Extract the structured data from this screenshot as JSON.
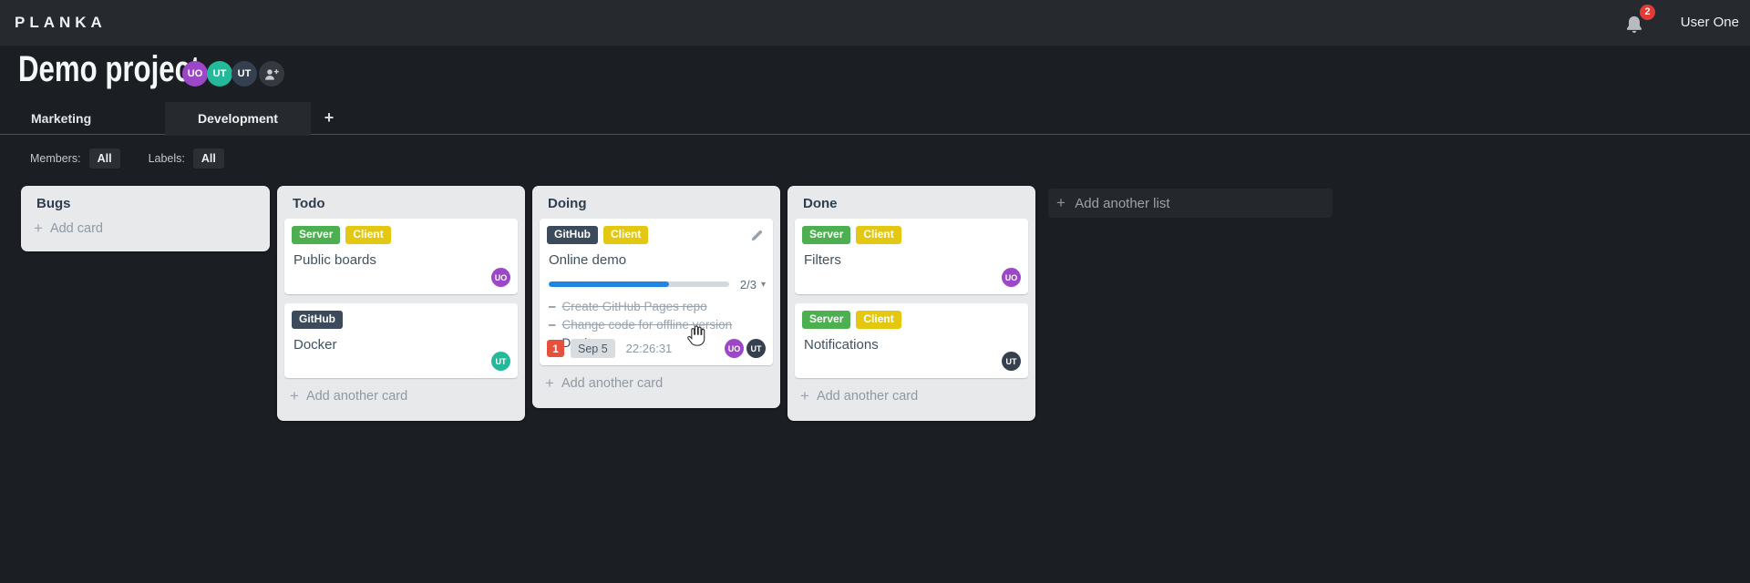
{
  "topbar": {
    "logo": "PLANKA",
    "user": "User One",
    "notification_count": "2"
  },
  "project": {
    "title": "Demo project",
    "members": [
      {
        "initials": "UO",
        "color": "#9c47c7"
      },
      {
        "initials": "UT",
        "color": "#23ba9b"
      },
      {
        "initials": "UT",
        "color": "#34404e"
      }
    ]
  },
  "tabs": {
    "items": [
      {
        "label": "Marketing"
      },
      {
        "label": "Development"
      }
    ],
    "add_button": "+"
  },
  "filters": {
    "members_label": "Members:",
    "members_value": "All",
    "labels_label": "Labels:",
    "labels_value": "All"
  },
  "board": {
    "add_list_label": "Add another list",
    "lists": [
      {
        "name": "Bugs",
        "add_card_label": "Add card",
        "cards": []
      },
      {
        "name": "Todo",
        "add_card_label": "Add another card",
        "cards": [
          {
            "title": "Public boards",
            "labels": [
              {
                "text": "Server",
                "color": "#4caf50"
              },
              {
                "text": "Client",
                "color": "#e3c711"
              }
            ],
            "members": [
              {
                "initials": "UO",
                "color": "#9c47c7"
              }
            ]
          },
          {
            "title": "Docker",
            "labels": [
              {
                "text": "GitHub",
                "color": "#3b4b5c"
              }
            ],
            "members": [
              {
                "initials": "UT",
                "color": "#23ba9b"
              }
            ]
          }
        ]
      },
      {
        "name": "Doing",
        "add_card_label": "Add another card",
        "cards": [
          {
            "title": "Online demo",
            "labels": [
              {
                "text": "GitHub",
                "color": "#3b4b5c"
              },
              {
                "text": "Client",
                "color": "#e3c711"
              }
            ],
            "progress": {
              "label": "2/3",
              "percent": 66.7,
              "color": "#2086e5"
            },
            "tasks": [
              {
                "text": "Create GitHub Pages repo",
                "done": true
              },
              {
                "text": "Change code for offline version",
                "done": true
              },
              {
                "text": "Deploy",
                "done": false
              }
            ],
            "notification_count": "1",
            "due_date": "Sep 5",
            "stopwatch": "22:26:31",
            "members": [
              {
                "initials": "UO",
                "color": "#9c47c7"
              },
              {
                "initials": "UT",
                "color": "#34404e"
              }
            ]
          }
        ]
      },
      {
        "name": "Done",
        "add_card_label": "Add another card",
        "cards": [
          {
            "title": "Filters",
            "labels": [
              {
                "text": "Server",
                "color": "#4caf50"
              },
              {
                "text": "Client",
                "color": "#e3c711"
              }
            ],
            "members": [
              {
                "initials": "UO",
                "color": "#9c47c7"
              }
            ]
          },
          {
            "title": "Notifications",
            "labels": [
              {
                "text": "Server",
                "color": "#4caf50"
              },
              {
                "text": "Client",
                "color": "#e3c711"
              }
            ],
            "members": [
              {
                "initials": "UT",
                "color": "#34404e"
              }
            ]
          }
        ]
      }
    ]
  },
  "glyphs": {
    "plus": "+",
    "caret_down": "▾",
    "dash": "–"
  }
}
